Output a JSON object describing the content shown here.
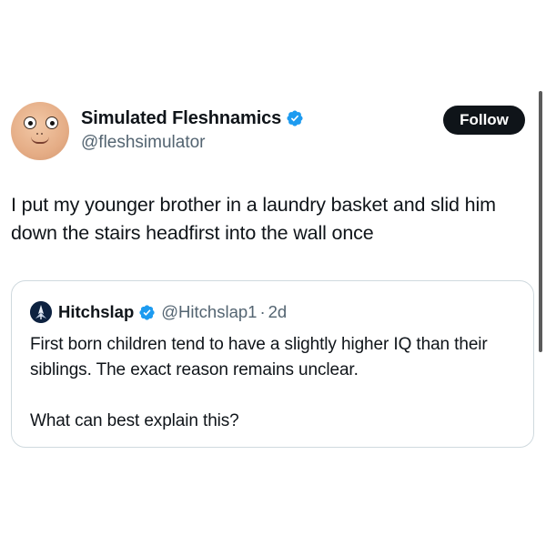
{
  "author": {
    "display_name": "Simulated Fleshnamics",
    "handle": "@fleshsimulator",
    "verified_icon": "verified-badge-icon",
    "avatar_icon": "cartoon-face-avatar"
  },
  "follow_button": {
    "label": "Follow"
  },
  "tweet": {
    "text": "I put my younger brother in a laundry basket and slid him down the stairs headfirst into the wall once"
  },
  "quoted_tweet": {
    "display_name": "Hitchslap",
    "handle": "@Hitchslap1",
    "separator": "·",
    "time": "2d",
    "verified_icon": "verified-badge-icon",
    "text": "First born children tend to have a slightly higher IQ than their siblings. The exact reason remains unclear.",
    "question": "What can best explain this?"
  },
  "colors": {
    "text_primary": "#0f1419",
    "text_secondary": "#536471",
    "verified_blue": "#1d9bf0",
    "follow_bg": "#0f1419",
    "card_border": "#cfd9de"
  }
}
